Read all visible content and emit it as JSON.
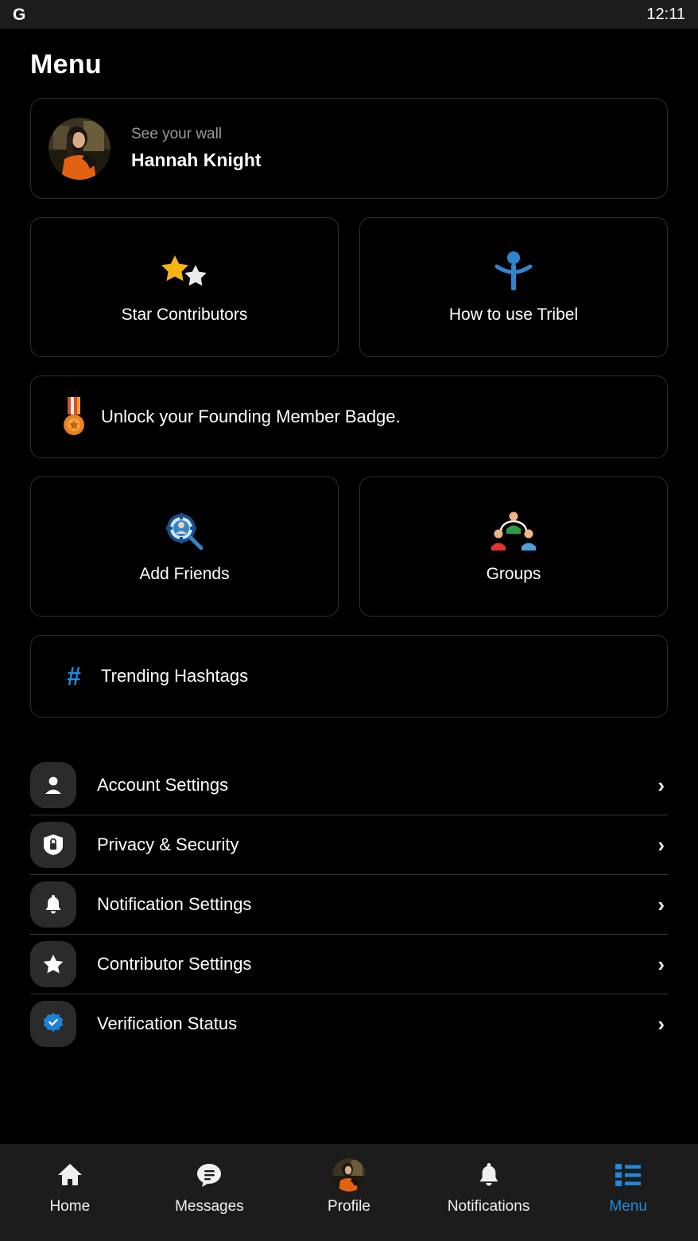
{
  "statusbar": {
    "app_icon": "google-g-icon",
    "time": "12:11"
  },
  "header": {
    "title": "Menu"
  },
  "profile_card": {
    "subtitle": "See your wall",
    "name": "Hannah Knight",
    "avatar_icon": "user-avatar"
  },
  "feature_cards": [
    {
      "label": "Star Contributors",
      "icon": "two-stars-icon"
    },
    {
      "label": "How to use Tribel",
      "icon": "person-arms-out-icon"
    },
    {
      "label": "Add Friends",
      "icon": "person-search-icon"
    },
    {
      "label": "Groups",
      "icon": "people-group-icon"
    }
  ],
  "banner_badge": {
    "label": "Unlock your Founding Member Badge.",
    "icon": "medal-icon"
  },
  "banner_hashtags": {
    "label": "Trending Hashtags",
    "icon": "hashtag-icon"
  },
  "settings": [
    {
      "label": "Account Settings",
      "icon": "person-icon",
      "chevron": "›"
    },
    {
      "label": "Privacy & Security",
      "icon": "shield-lock-icon",
      "chevron": "›"
    },
    {
      "label": "Notification Settings",
      "icon": "bell-icon",
      "chevron": "›"
    },
    {
      "label": "Contributor Settings",
      "icon": "star-icon",
      "chevron": "›"
    },
    {
      "label": "Verification Status",
      "icon": "verified-badge-icon",
      "chevron": "›"
    }
  ],
  "bottom_nav": [
    {
      "label": "Home",
      "icon": "home-icon",
      "active": false
    },
    {
      "label": "Messages",
      "icon": "chat-bubble-icon",
      "active": false
    },
    {
      "label": "Profile",
      "icon": "user-avatar",
      "active": false
    },
    {
      "label": "Notifications",
      "icon": "bell-icon",
      "active": false
    },
    {
      "label": "Menu",
      "icon": "list-menu-icon",
      "active": true
    }
  ],
  "colors": {
    "accent_blue": "#2089dd",
    "background": "#000000",
    "surface": "#1c1c1c",
    "icon_chip": "#2b2b2b",
    "divider": "#383838",
    "muted_text": "#9a9a9a",
    "gold_star": "#f5b412",
    "silver_star": "#e8e8e8"
  }
}
